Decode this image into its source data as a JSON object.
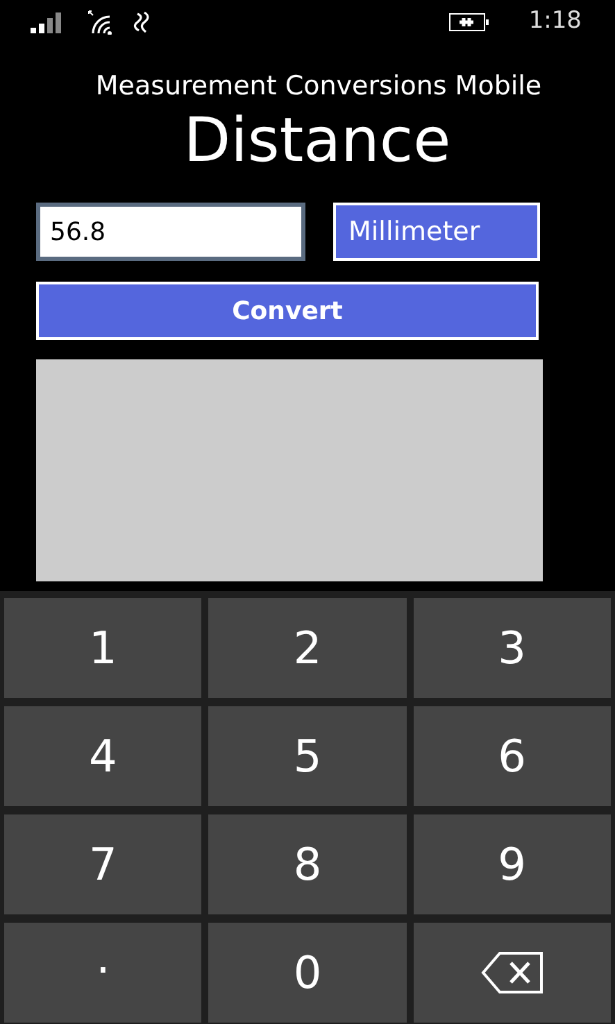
{
  "status_bar": {
    "time": "1:18"
  },
  "app_title": "Measurement Conversions Mobile",
  "page_title": "Distance",
  "value_field": {
    "value": "56.8"
  },
  "unit_dropdown": {
    "value": "Millimeter"
  },
  "convert_button": "Convert",
  "keypad": [
    {
      "kind": "digit",
      "label": "1"
    },
    {
      "kind": "digit",
      "label": "2"
    },
    {
      "kind": "digit",
      "label": "3"
    },
    {
      "kind": "digit",
      "label": "4"
    },
    {
      "kind": "digit",
      "label": "5"
    },
    {
      "kind": "digit",
      "label": "6"
    },
    {
      "kind": "digit",
      "label": "7"
    },
    {
      "kind": "digit",
      "label": "8"
    },
    {
      "kind": "digit",
      "label": "9"
    },
    {
      "kind": "decimal",
      "label": "."
    },
    {
      "kind": "digit",
      "label": "0"
    },
    {
      "kind": "backspace"
    }
  ]
}
